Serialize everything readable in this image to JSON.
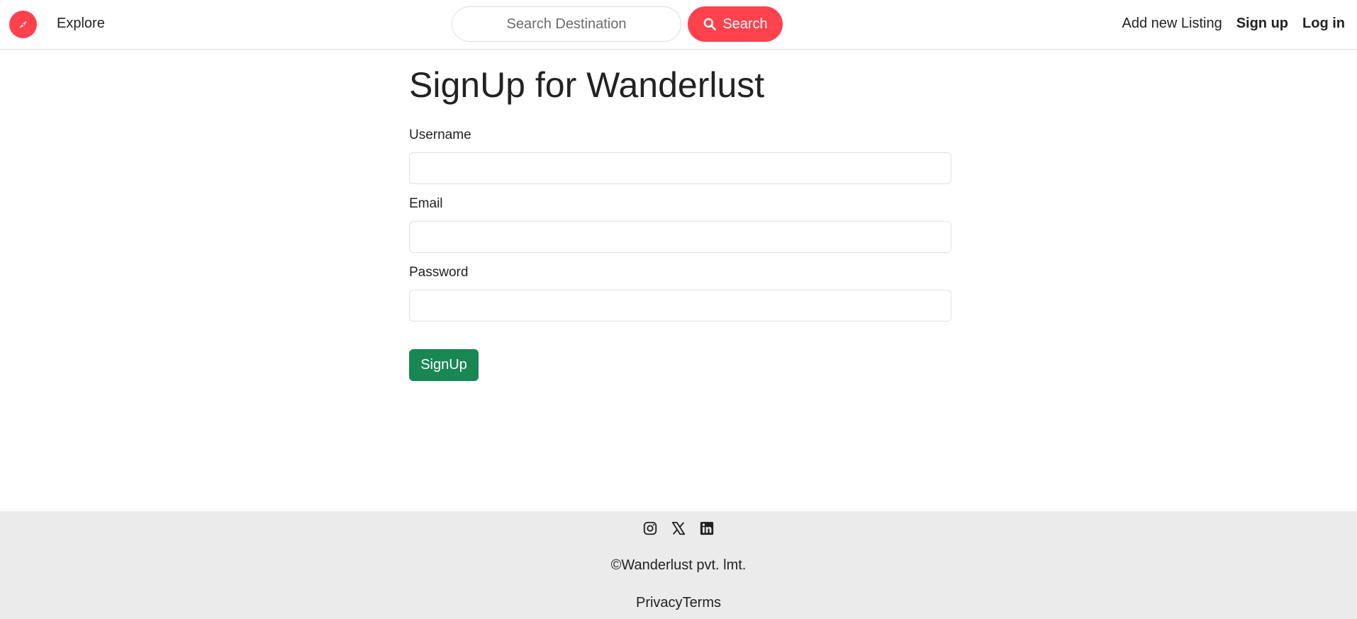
{
  "navbar": {
    "logo_icon": "compass-icon",
    "brand_color": "#fe424d",
    "explore_label": "Explore",
    "search": {
      "placeholder": "Search Destination",
      "value": "",
      "button_label": "Search",
      "button_icon": "search-icon"
    },
    "links": {
      "add_listing": "Add new Listing",
      "signup": "Sign up",
      "login": "Log in"
    }
  },
  "form": {
    "title": "SignUp for Wanderlust",
    "fields": {
      "username": {
        "label": "Username",
        "value": ""
      },
      "email": {
        "label": "Email",
        "value": ""
      },
      "password": {
        "label": "Password",
        "value": ""
      }
    },
    "submit_label": "SignUp",
    "submit_color": "#198754"
  },
  "footer": {
    "socials": [
      "instagram-icon",
      "x-twitter-icon",
      "linkedin-icon"
    ],
    "copyright": "©Wanderlust pvt. lmt.",
    "links": {
      "privacy": "Privacy",
      "terms": "Terms"
    },
    "background": "#ebebeb"
  }
}
